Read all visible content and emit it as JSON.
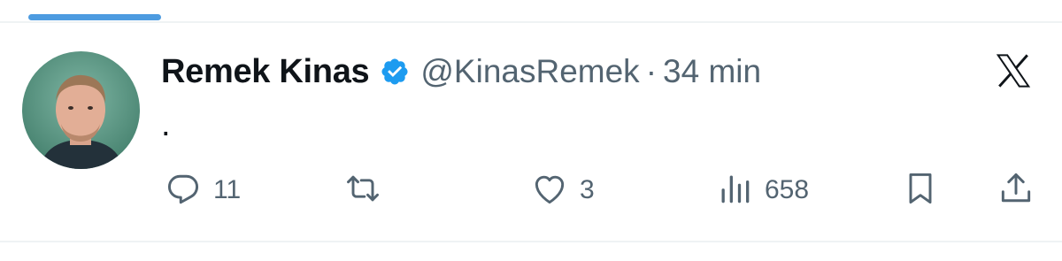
{
  "colors": {
    "accent": "#4d9be0",
    "verified": "#1d9bf0",
    "text_primary": "#0f1419",
    "text_secondary": "#536471",
    "divider": "#eff3f4"
  },
  "tweet": {
    "author": {
      "display_name": "Remek Kinas",
      "verified": true,
      "handle": "@KinasRemek"
    },
    "separator": "·",
    "time": "34 min",
    "text": "."
  },
  "actions": {
    "reply": {
      "icon": "reply-icon",
      "count": "11"
    },
    "retweet": {
      "icon": "retweet-icon",
      "count": ""
    },
    "like": {
      "icon": "heart-icon",
      "count": "3"
    },
    "views": {
      "icon": "views-icon",
      "count": "658"
    },
    "bookmark": {
      "icon": "bookmark-icon"
    },
    "share": {
      "icon": "share-icon"
    }
  },
  "brand": {
    "icon": "x-logo-icon"
  }
}
